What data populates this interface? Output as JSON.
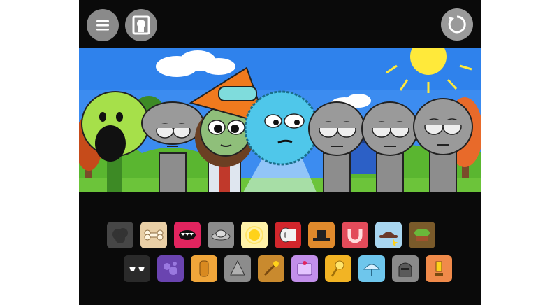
{
  "header": {
    "menu_icon": "hamburger-menu-icon",
    "bonus_icon": "bonus-portrait-icon",
    "reset_icon": "reset-icon"
  },
  "stage": {
    "background": "sky-grass-scene",
    "characters": [
      {
        "name": "green-pea-shooter",
        "color": "#a6e04a"
      },
      {
        "name": "gray-sprunki-1",
        "color": "#9a9a9a"
      },
      {
        "name": "kid-orange-hat",
        "color": "#f07a1e"
      },
      {
        "name": "blue-fluffy-ball",
        "color": "#4fc7ea"
      },
      {
        "name": "gray-sprunki-2",
        "color": "#9a9a9a"
      },
      {
        "name": "gray-sprunki-3",
        "color": "#9a9a9a"
      },
      {
        "name": "gray-sprunki-4",
        "color": "#9a9a9a"
      }
    ]
  },
  "palette": {
    "row1": [
      {
        "icon": "gray-smoke-icon",
        "bg": "#777777",
        "used": true
      },
      {
        "icon": "bone-icon",
        "bg": "#e9cfa6"
      },
      {
        "icon": "fanged-mouth-icon",
        "bg": "#e2245f"
      },
      {
        "icon": "ufo-icon",
        "bg": "#8c8c8c"
      },
      {
        "icon": "sun-glow-icon",
        "bg": "#fff2a8"
      },
      {
        "icon": "toilet-paper-icon",
        "bg": "#d2262c"
      },
      {
        "icon": "black-hat-icon",
        "bg": "#e08a2c"
      },
      {
        "icon": "magnet-icon",
        "bg": "#e24b5a"
      },
      {
        "icon": "fedora-star-icon",
        "bg": "#a9d6f0"
      },
      {
        "icon": "leaf-pot-icon",
        "bg": "#7a5a2a"
      }
    ],
    "row2": [
      {
        "icon": "sunglasses-icon",
        "bg": "#2a2a2a"
      },
      {
        "icon": "purple-bubbles-icon",
        "bg": "#6a44b0"
      },
      {
        "icon": "golden-stack-icon",
        "bg": "#f0a63a"
      },
      {
        "icon": "gray-cone-icon",
        "bg": "#8c8c8c"
      },
      {
        "icon": "golden-wand-icon",
        "bg": "#c98a2e"
      },
      {
        "icon": "purple-box-icon",
        "bg": "#c28fea"
      },
      {
        "icon": "sun-staff-icon",
        "bg": "#f2b424"
      },
      {
        "icon": "umbrella-icon",
        "bg": "#6ec6ec"
      },
      {
        "icon": "knight-helmet-icon",
        "bg": "#8a8a8a"
      },
      {
        "icon": "trophy-icon",
        "bg": "#f08a4a"
      }
    ]
  }
}
